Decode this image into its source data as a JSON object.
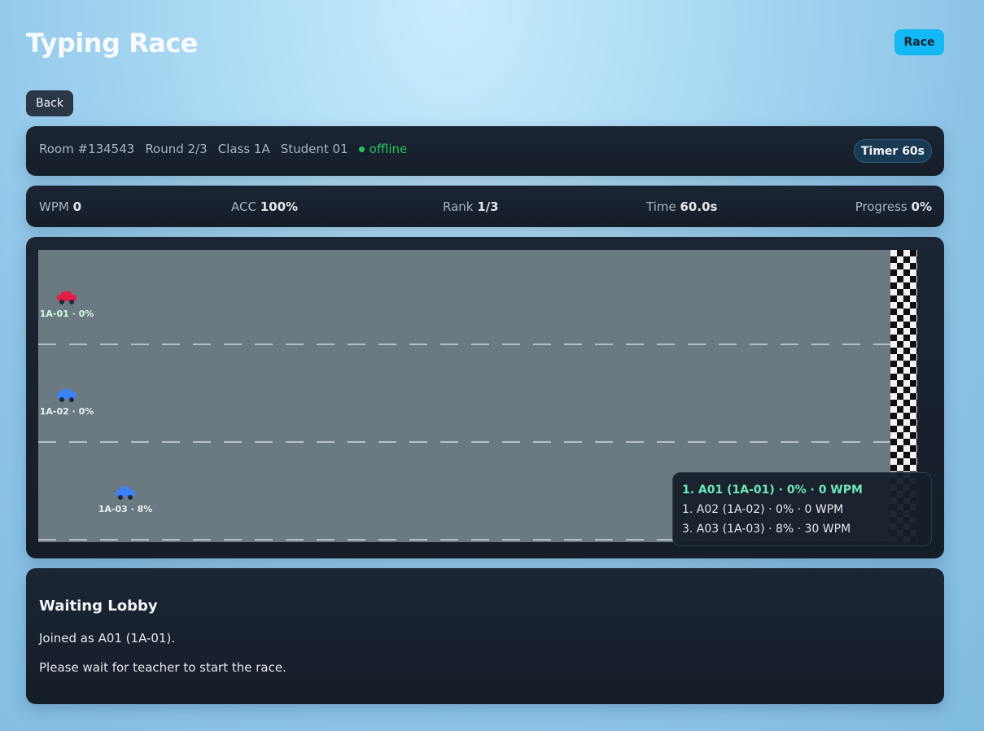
{
  "header": {
    "title": "Typing Race",
    "race_button": "Race"
  },
  "nav": {
    "back_label": "Back"
  },
  "info": {
    "room": "Room #134543",
    "round": "Round 2/3",
    "class": "Class 1A",
    "student": "Student 01",
    "status": "offline",
    "status_color": "#22c55e",
    "timer": "Timer 60s"
  },
  "stats": {
    "wpm_label": "WPM",
    "wpm_value": "0",
    "acc_label": "ACC",
    "acc_value": "100%",
    "rank_label": "Rank",
    "rank_value": "1/3",
    "time_label": "Time",
    "time_value": "60.0s",
    "progress_label": "Progress",
    "progress_value": "0%"
  },
  "track": {
    "cars": [
      {
        "label": "1A-01 · 0%",
        "progress": 0,
        "color": "#e11d48",
        "icon": "red-car-icon"
      },
      {
        "label": "1A-02 · 0%",
        "progress": 0,
        "color": "#3b82f6",
        "icon": "blue-car-icon"
      },
      {
        "label": "1A-03 · 8%",
        "progress": 8,
        "color": "#3b82f6",
        "icon": "blue-car-icon"
      }
    ],
    "finish_icon": "checkered-flag-finish-line"
  },
  "leaderboard": [
    "1. A01 (1A-01) · 0% · 0 WPM",
    "1. A02 (1A-02) · 0% · 0 WPM",
    "3. A03 (1A-03) · 8% · 30 WPM"
  ],
  "lobby": {
    "title": "Waiting Lobby",
    "joined": "Joined as A01 (1A-01).",
    "wait_message": "Please wait for teacher to start the race."
  },
  "colors": {
    "accent": "#14b8f5",
    "card": "#1b2533",
    "track": "#6b7a80",
    "leader_highlight": "#6ee7b7"
  }
}
